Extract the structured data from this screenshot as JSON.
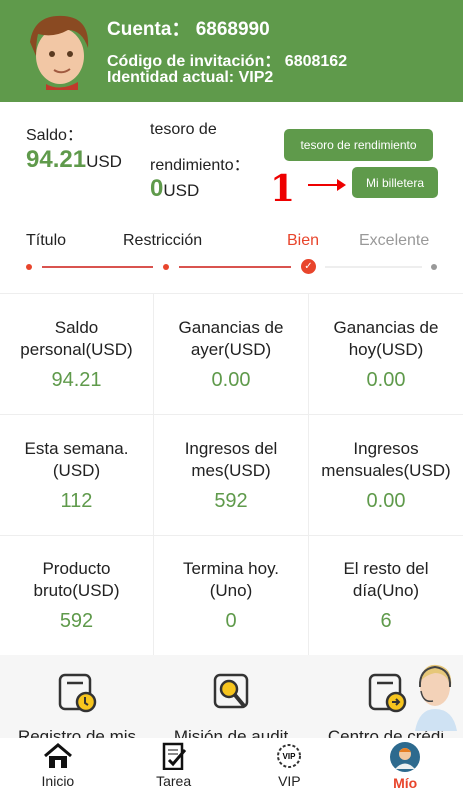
{
  "header": {
    "account_label": "Cuenta：",
    "account": "6868990",
    "invite_label": "Código de invitación：",
    "invite": "6808162",
    "identity": "Identidad actual: VIP2"
  },
  "balance": {
    "label": "Saldo：",
    "value": "94.21",
    "unit": "USD",
    "treasure_label_1": "tesoro de",
    "treasure_label_2": "rendimiento：",
    "treasure_value": "0",
    "treasure_unit": "USD"
  },
  "buttons": {
    "treasure": "tesoro de rendimiento",
    "wallet": "Mi billetera"
  },
  "annotation": {
    "number": "1"
  },
  "steps": [
    {
      "label": "Título"
    },
    {
      "label": "Restricción"
    },
    {
      "label": "Bien"
    },
    {
      "label": "Excelente"
    }
  ],
  "stats": [
    {
      "label": "Saldo personal(USD)",
      "value": "94.21"
    },
    {
      "label": "Ganancias de ayer(USD)",
      "value": "0.00"
    },
    {
      "label": "Ganancias de hoy(USD)",
      "value": "0.00"
    },
    {
      "label": "Esta semana.(USD)",
      "value": "112"
    },
    {
      "label": "Ingresos del mes(USD)",
      "value": "592"
    },
    {
      "label": "Ingresos mensuales(USD)",
      "value": "0.00"
    },
    {
      "label": "Producto bruto(USD)",
      "value": "592"
    },
    {
      "label": "Termina hoy.(Uno)",
      "value": "0"
    },
    {
      "label": "El resto del día(Uno)",
      "value": "6"
    }
  ],
  "features": [
    {
      "label": "Registro de mis"
    },
    {
      "label": "Misión de audit"
    },
    {
      "label": "Centro de crédi"
    }
  ],
  "tabs": [
    {
      "label": "Inicio"
    },
    {
      "label": "Tarea"
    },
    {
      "label": "VIP"
    },
    {
      "label": "Mío"
    }
  ],
  "colors": {
    "green": "#5f9a4b",
    "red": "#e8452c",
    "active_tab": "#e8452c"
  }
}
